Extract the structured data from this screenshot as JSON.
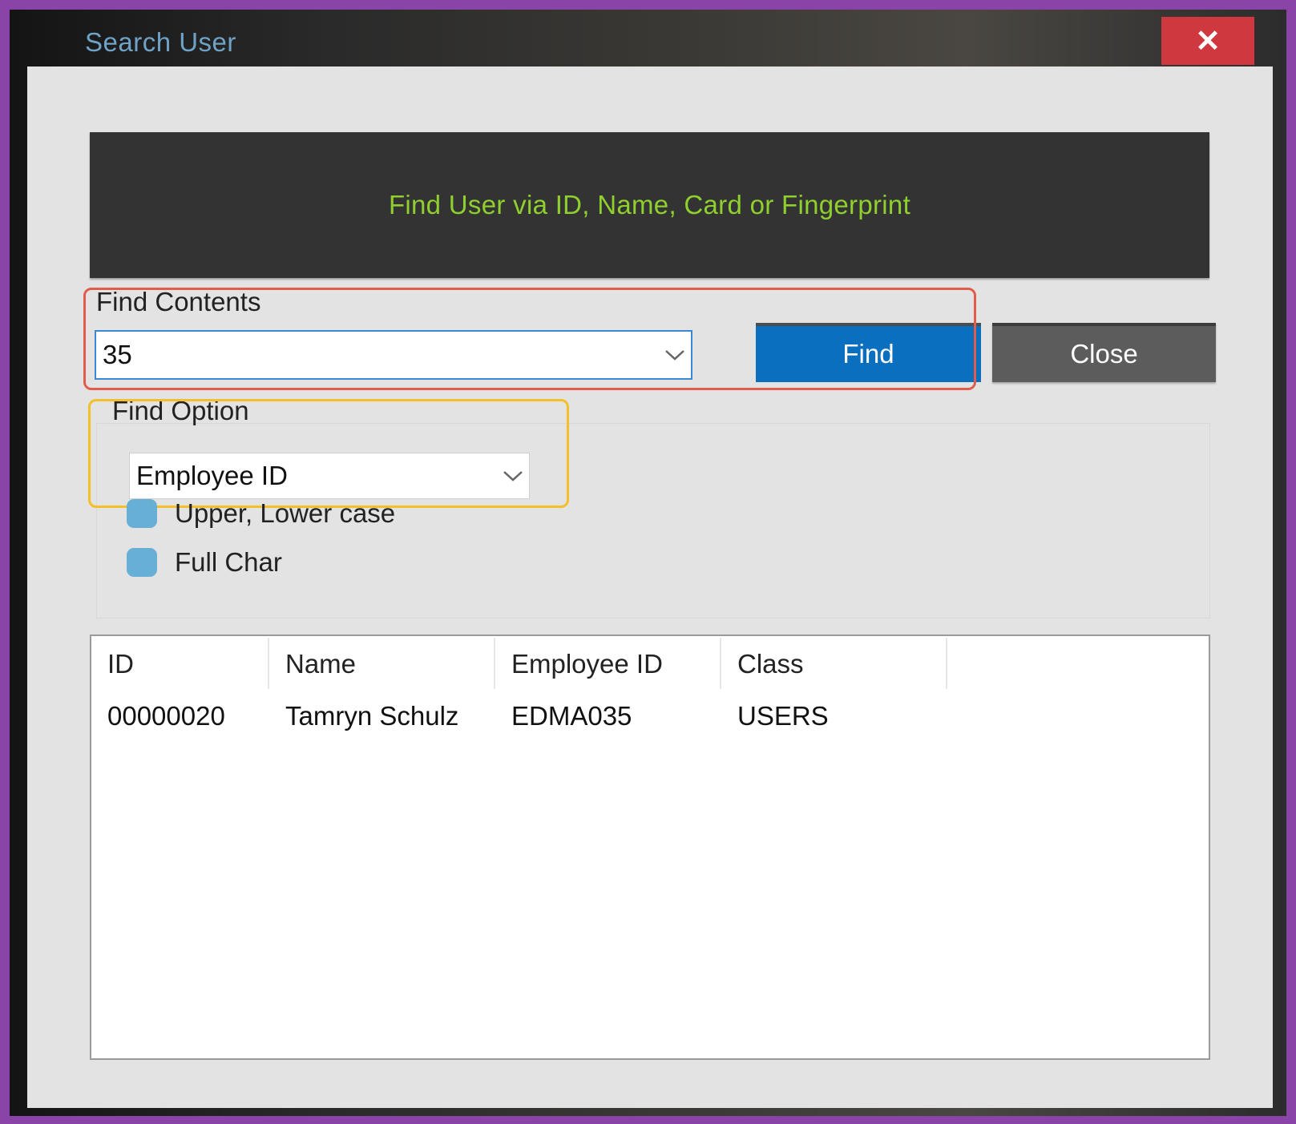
{
  "window": {
    "title": "Search User",
    "close_glyph": "✕"
  },
  "banner": {
    "text": "Find User via ID, Name, Card or Fingerprint",
    "text_color": "#8fcf2e",
    "background": "#333333"
  },
  "find_contents": {
    "label": "Find Contents",
    "value": "35"
  },
  "buttons": {
    "find_label": "Find",
    "close_label": "Close",
    "find_color": "#0a6fbf",
    "close_color": "#5c5c5c"
  },
  "find_option": {
    "label": "Find Option",
    "selected": "Employee ID",
    "checkboxes": [
      {
        "label": "Upper, Lower case"
      },
      {
        "label": "Full Char"
      }
    ]
  },
  "results": {
    "columns": [
      "ID",
      "Name",
      "Employee ID",
      "Class"
    ],
    "rows": [
      [
        "00000020",
        "Tamryn Schulz",
        "EDMA035",
        "USERS"
      ]
    ]
  },
  "highlights": {
    "red": "#e25c4e",
    "yellow": "#f4c02a"
  }
}
